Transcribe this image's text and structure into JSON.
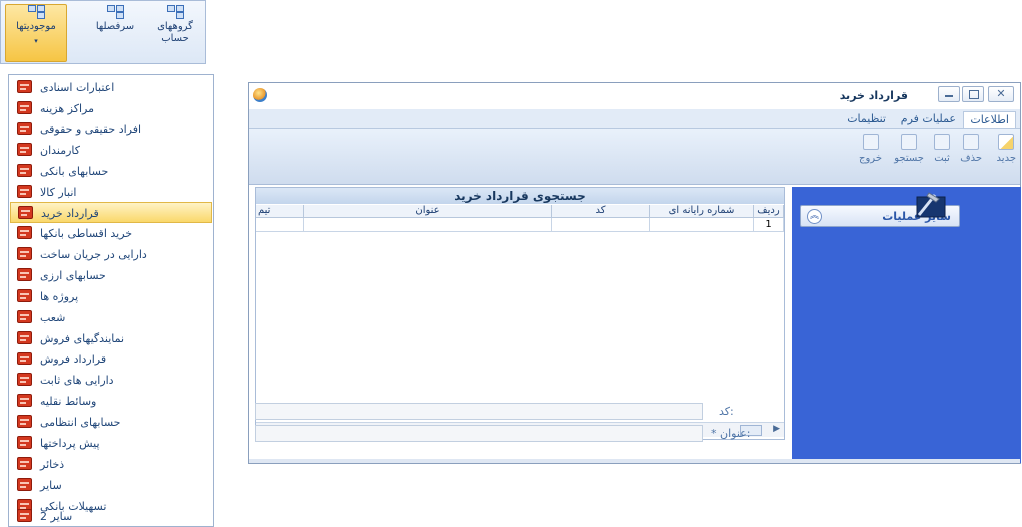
{
  "ribbon": {
    "buttons": [
      {
        "label": "گروههای حساب",
        "icon": "tree-icon"
      },
      {
        "label": "سرفصلها",
        "icon": "tree-icon"
      },
      {
        "label": "موجودیتها",
        "icon": "tree-icon",
        "active": true
      }
    ],
    "dropdown_arrow": "▾"
  },
  "menu": {
    "items": [
      {
        "label": "اعتبارات اسنادی"
      },
      {
        "label": "مراکز هزینه"
      },
      {
        "label": "افراد حقیقی و حقوقی"
      },
      {
        "label": "کارمندان"
      },
      {
        "label": "حسابهای بانکی"
      },
      {
        "label": "انبار کالا"
      },
      {
        "label": "قرارداد خرید",
        "selected": true
      },
      {
        "label": "خرید اقساطی بانکها"
      },
      {
        "label": "دارایی در جریان ساخت"
      },
      {
        "label": "حسابهای ارزی"
      },
      {
        "label": "پروژه ها"
      },
      {
        "label": "شعب"
      },
      {
        "label": "نمایندگیهای فروش"
      },
      {
        "label": "قرارداد فروش"
      },
      {
        "label": "دارایی های ثابت"
      },
      {
        "label": "وسائط نقلیه"
      },
      {
        "label": "حسابهای انتظامی"
      },
      {
        "label": "پیش پرداختها"
      },
      {
        "label": "ذخائر"
      },
      {
        "label": "سایر"
      },
      {
        "label": "تسهیلات بانکی"
      },
      {
        "label": "سایر 2"
      }
    ]
  },
  "window": {
    "title": "قرارداد خرید",
    "close_glyph": "✕",
    "tabs": [
      {
        "label": "اطلاعات",
        "active": true
      },
      {
        "label": "عملیات فرم"
      },
      {
        "label": "تنظیمات"
      }
    ],
    "toolbar": {
      "new": "جدید",
      "delete": "حذف",
      "save": "ثبت",
      "search": "جستجو",
      "exit": "خروج"
    },
    "search_panel": {
      "title": "جستجوی قرارداد خرید",
      "columns": [
        "ردیف",
        "شماره رایانه ای",
        "کد",
        "عنوان",
        "تیم"
      ],
      "rows": [
        [
          "1",
          "",
          "",
          "",
          ""
        ]
      ],
      "scroll_left": "◀",
      "scroll_right": "▶"
    },
    "fields": {
      "code_label": "کد:",
      "title_label": "* عنوان:",
      "code_value": "",
      "title_value": ""
    },
    "side": {
      "ops_label": "سایر عملیات",
      "ops_chevron": "︽"
    }
  },
  "colors": {
    "side_panel": "#3964d6",
    "menu_selected": "#fad86b",
    "menu_icon": "#d3381f"
  }
}
